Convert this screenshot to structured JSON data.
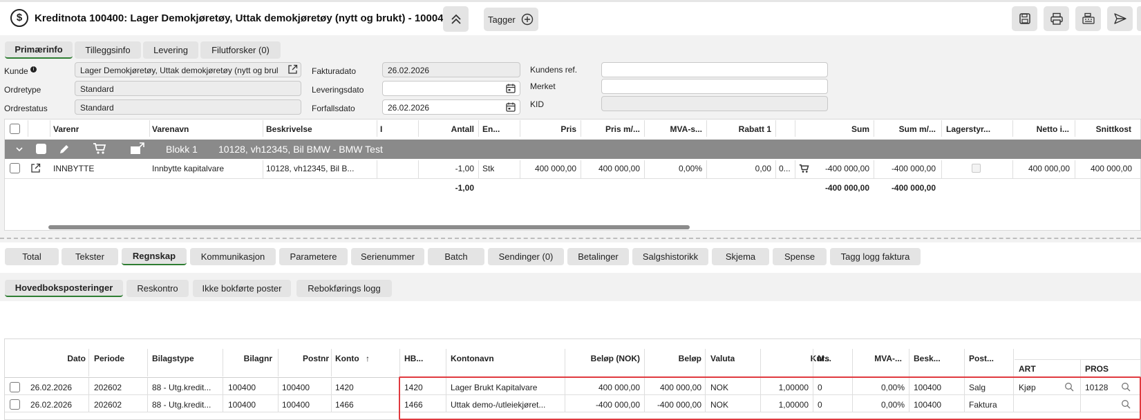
{
  "title": "Kreditnota 100400: Lager Demokjøretøy, Uttak demokjøretøy (nytt og brukt) - 10004",
  "header": {
    "tag_button": "Tagger"
  },
  "tabs_top": [
    {
      "label": "Primærinfo"
    },
    {
      "label": "Tilleggsinfo"
    },
    {
      "label": "Levering"
    },
    {
      "label": "Filutforsker (0)"
    }
  ],
  "form": {
    "kunde_label": "Kunde",
    "kunde_value": "Lager Demokjøretøy, Uttak demokjøretøy (nytt og brul",
    "ordretype_label": "Ordretype",
    "ordretype_value": "Standard",
    "ordrestatus_label": "Ordrestatus",
    "ordrestatus_value": "Standard",
    "fakturadato_label": "Fakturadato",
    "fakturadato_value": "26.02.2026",
    "leveringsdato_label": "Leveringsdato",
    "leveringsdato_value": "",
    "forfallsdato_label": "Forfallsdato",
    "forfallsdato_value": "26.02.2026",
    "kundens_ref_label": "Kundens ref.",
    "merket_label": "Merket",
    "kid_label": "KID"
  },
  "order_grid": {
    "headers": [
      "Varenr",
      "Varenavn",
      "Beskrivelse",
      "I",
      "Antall",
      "En...",
      "Pris",
      "Pris m/...",
      "MVA-s...",
      "Rabatt 1",
      "Sum",
      "Sum m/...",
      "Lagerstyr...",
      "Netto i...",
      "Snittkost"
    ],
    "block": {
      "name": "Blokk 1",
      "desc": "10128, vh12345, Bil BMW - BMW Test"
    },
    "row": {
      "varenr": "INNBYTTE",
      "varenavn": "Innbytte kapitalvare",
      "beskrivelse": "10128, vh12345, Bil B...",
      "antall": "-1,00",
      "enhet": "Stk",
      "pris": "400 000,00",
      "pris_mva": "400 000,00",
      "mva_sats": "0,00%",
      "rabatt": "0,00",
      "extra": "0...",
      "sum": "-400 000,00",
      "sum_mva": "-400 000,00",
      "netto": "400 000,00",
      "snittkost": "400 000,00"
    },
    "totals": {
      "antall": "-1,00",
      "sum": "-400 000,00",
      "sum_mva": "-400 000,00"
    }
  },
  "tabs_mid": [
    {
      "label": "Total"
    },
    {
      "label": "Tekster"
    },
    {
      "label": "Regnskap"
    },
    {
      "label": "Kommunikasjon"
    },
    {
      "label": "Parametere"
    },
    {
      "label": "Serienummer"
    },
    {
      "label": "Batch"
    },
    {
      "label": "Sendinger (0)"
    },
    {
      "label": "Betalinger"
    },
    {
      "label": "Salgshistorikk"
    },
    {
      "label": "Skjema"
    },
    {
      "label": "Spense"
    },
    {
      "label": "Tagg logg faktura"
    }
  ],
  "tabs_sub": [
    {
      "label": "Hovedboksposteringer"
    },
    {
      "label": "Reskontro"
    },
    {
      "label": "Ikke bokførte poster"
    },
    {
      "label": "Rebokførings logg"
    }
  ],
  "ledger": {
    "headers": [
      "Dato",
      "Periode",
      "Bilagstype",
      "Bilagnr",
      "Postnr",
      "Konto",
      "HB...",
      "Kontonavn",
      "Beløp (NOK)",
      "Beløp",
      "Valuta",
      "Kurs",
      "M...",
      "MVA-...",
      "Besk...",
      "Post..."
    ],
    "sort_arrow": "↑",
    "group_headers": [
      "ART",
      "PROS"
    ],
    "rows": [
      {
        "dato": "26.02.2026",
        "periode": "202602",
        "bilagstype": "88 - Utg.kredit...",
        "bilagnr": "100400",
        "postnr": "100400",
        "konto": "1420",
        "hb": "1420",
        "kontonavn": "Lager Brukt Kapitalvare",
        "belop_nok": "400 000,00",
        "belop": "400 000,00",
        "valuta": "NOK",
        "kurs": "1,00000",
        "m": "0",
        "mva": "0,00%",
        "besk": "100400",
        "post": "Salg",
        "art": "Kjøp",
        "pros": "10128"
      },
      {
        "dato": "26.02.2026",
        "periode": "202602",
        "bilagstype": "88 - Utg.kredit...",
        "bilagnr": "100400",
        "postnr": "100400",
        "konto": "1466",
        "hb": "1466",
        "kontonavn": "Uttak demo-/utleiekjøret...",
        "belop_nok": "-400 000,00",
        "belop": "-400 000,00",
        "valuta": "NOK",
        "kurs": "1,00000",
        "m": "0",
        "mva": "0,00%",
        "besk": "100400",
        "post": "Faktura",
        "art": "",
        "pros": ""
      }
    ]
  }
}
